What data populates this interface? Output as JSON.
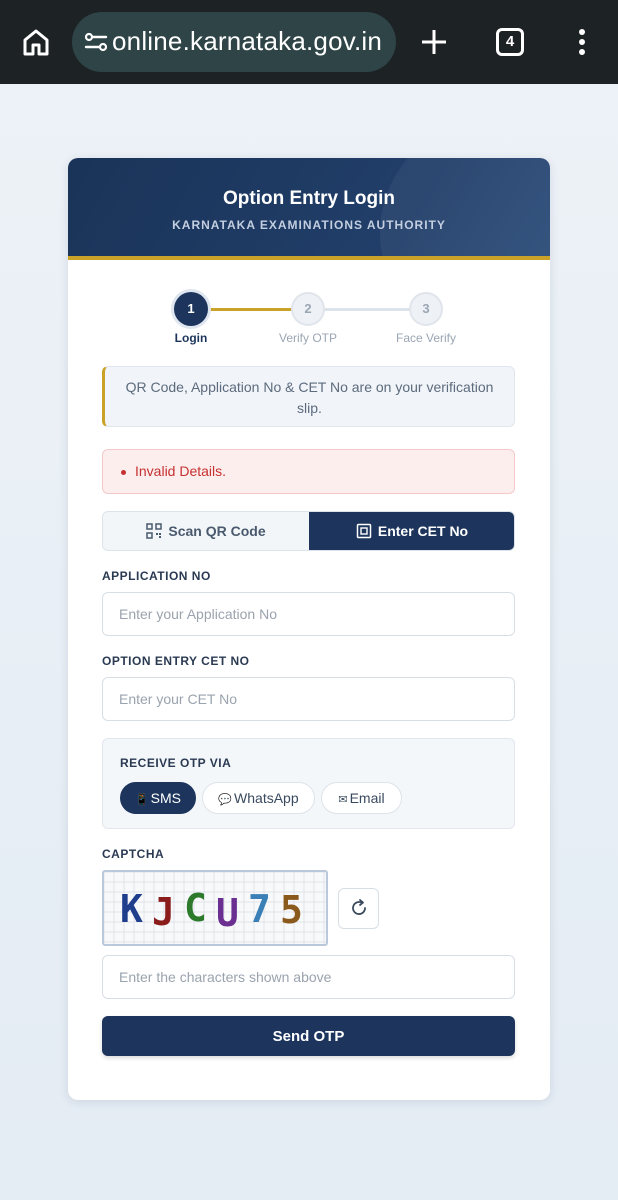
{
  "browser": {
    "url": "online.karnataka.gov.in",
    "tab_count": "4"
  },
  "header": {
    "title": "Option Entry Login",
    "subtitle": "KARNATAKA EXAMINATIONS AUTHORITY"
  },
  "stepper": {
    "steps": [
      {
        "number": "1",
        "label": "Login",
        "active": true
      },
      {
        "number": "2",
        "label": "Verify OTP",
        "active": false
      },
      {
        "number": "3",
        "label": "Face Verify",
        "active": false
      }
    ]
  },
  "info_text": "QR Code, Application No & CET No are on your verification slip.",
  "error_text": "Invalid Details.",
  "mode_tabs": [
    {
      "label": "Scan QR Code",
      "selected": false
    },
    {
      "label": "Enter CET No",
      "selected": true
    }
  ],
  "fields": {
    "application": {
      "label": "APPLICATION NO",
      "placeholder": "Enter your Application No",
      "value": ""
    },
    "cet": {
      "label": "OPTION ENTRY CET NO",
      "placeholder": "Enter your CET No",
      "value": ""
    }
  },
  "otp": {
    "label": "RECEIVE OTP VIA",
    "options": [
      {
        "label": "SMS",
        "icon": "phone-icon",
        "selected": true
      },
      {
        "label": "WhatsApp",
        "icon": "chat-bubble-icon",
        "selected": false
      },
      {
        "label": "Email",
        "icon": "envelope-icon",
        "selected": false
      }
    ]
  },
  "captcha": {
    "label": "CAPTCHA",
    "code": "KJCU75",
    "char_colors": [
      "#1f3e8c",
      "#8b1c1c",
      "#2d7a2d",
      "#6a2f91",
      "#3a7fb5",
      "#8a5a1c"
    ],
    "placeholder": "Enter the characters shown above",
    "value": ""
  },
  "submit_label": "Send OTP",
  "colors": {
    "primary": "#1d355d",
    "accent": "#c9a227",
    "error": "#c53030"
  }
}
